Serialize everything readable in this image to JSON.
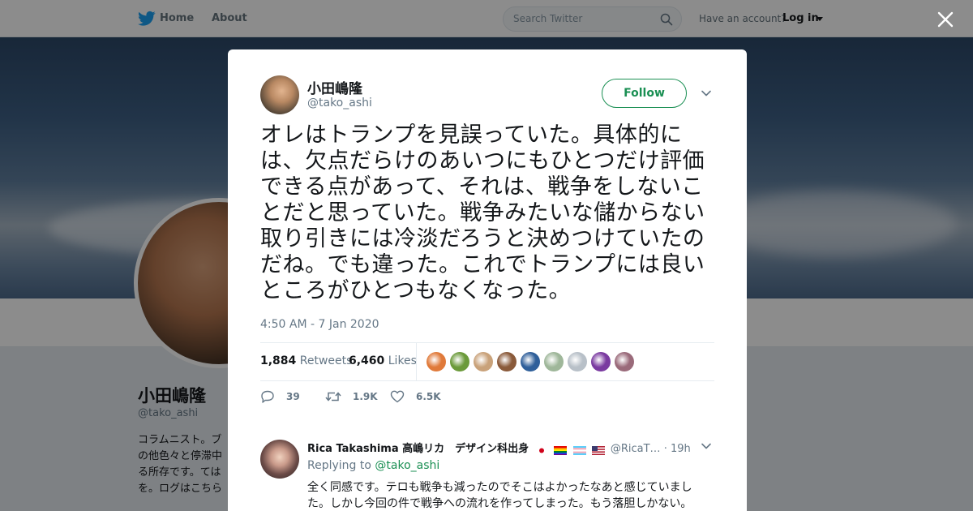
{
  "topbar": {
    "home_label": "Home",
    "about_label": "About",
    "search_placeholder": "Search Twitter",
    "have_account": "Have an account?",
    "login_label": "Log in",
    "brand_color": "#1da1f2"
  },
  "profile_background": {
    "name": "小田嶋隆",
    "handle": "@tako_ashi",
    "bio_visible": "コラムニスト。ブ\nの他色々と停滞中\nる所存です。ては\nを。ログはこちら"
  },
  "tweet": {
    "author_name": "小田嶋隆",
    "author_handle": "@tako_ashi",
    "follow_label": "Follow",
    "text": "オレはトランプを見誤っていた。具体的には、欠点だらけのあいつにもひとつだけ評価できる点があって、それは、戦争をしないことだと思っていた。戦争みたいな儲からない取り引きには冷淡だろうと決めつけていたのだね。でも違った。これでトランプには良いところがひとつもなくなった。",
    "timestamp": "4:50 AM - 7 Jan 2020",
    "retweets_count": "1,884",
    "retweets_label": "Retweets",
    "likes_count": "6,460",
    "likes_label": "Likes",
    "liker_avatar_colors": [
      "#e07a3a",
      "#6b9a3a",
      "#c9a27a",
      "#8a5a3a",
      "#2f5f9a",
      "#9fb79a",
      "#b8c0c8",
      "#7a3aa0",
      "#9a6a7a"
    ],
    "action_reply_count": "39",
    "action_retweet_count": "1.9K",
    "action_like_count": "6.5K",
    "accent_color": "#1a8f53"
  },
  "reply": {
    "author_name": "Rica Takashima 高嶋リカ　デザイン科出身",
    "author_handle": "@RicaT…",
    "time": "· 19h",
    "replying_to_label": "Replying to",
    "replying_to_handle": "@tako_ashi",
    "text": "全く同感です。テロも戦争も減ったのでそこはよかったなあと感じていました。しかし今回の件で戦争への流れを作ってしまった。もう落胆しかない。"
  }
}
